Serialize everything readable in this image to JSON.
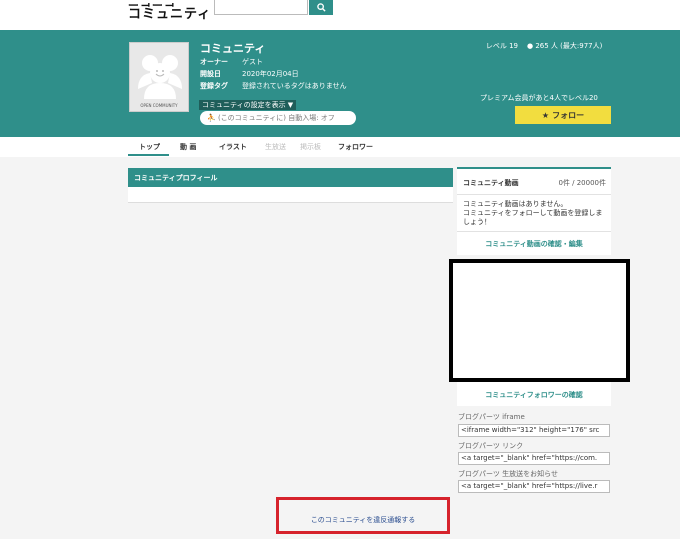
{
  "topbar": {
    "logo_line1": "ニコニコ",
    "logo_line2": "コミュニティ",
    "search_placeholder": ""
  },
  "header": {
    "title": "コミュニティ",
    "owner_label": "オーナー",
    "owner_value": "ゲスト",
    "opened_label": "開設日",
    "opened_value": "2020年02月04日",
    "tags_label": "登録タグ",
    "tags_value": "登録されているタグはありません",
    "thumb_caption": "OPEN COMMUNITY",
    "settings_label": "コミュニティの設定を表示 ▼",
    "join_label": "(このコミュニティに) 自動入場: オフ",
    "level_label": "レベル 19",
    "members_label": "265 人 (最大:977人)",
    "premium_text": "プレミアム会員があと4人でレベル20",
    "follow_label": "フォロー"
  },
  "tabs": [
    {
      "label": "トップ",
      "active": true
    },
    {
      "label": "動 画",
      "active": false
    },
    {
      "label": "イラスト",
      "active": false
    },
    {
      "label": "生放送",
      "active": false,
      "disabled": true
    },
    {
      "label": "掲示板",
      "active": false,
      "disabled": true
    },
    {
      "label": "フォロワー",
      "active": false
    }
  ],
  "profile": {
    "title": "コミュニティプロフィール"
  },
  "video_panel": {
    "title": "コミュニティ動画",
    "count": "0件 / 20000件",
    "message_line1": "コミュニティ動画はありません。",
    "message_line2": "コミュニティをフォローして動画を登録しましょう！",
    "link": "コミュニティ動画の確認・編集"
  },
  "follow_panel": {
    "link": "コミュニティフォロワーの確認"
  },
  "blog_parts": [
    {
      "label": "ブログパーツ iframe",
      "value": "<iframe width=\"312\" height=\"176\" src"
    },
    {
      "label": "ブログパーツ リンク",
      "value": "<a target=\"_blank\" href=\"https://com."
    },
    {
      "label": "ブログパーツ 生放送をお知らせ",
      "value": "<a target=\"_blank\" href=\"https://live.r"
    }
  ],
  "report": {
    "link": "このコミュニティを違反通報する"
  },
  "colors": {
    "brand": "#2f8f8a",
    "follow_button": "#f2dd3f",
    "report_highlight": "#d6232c"
  }
}
